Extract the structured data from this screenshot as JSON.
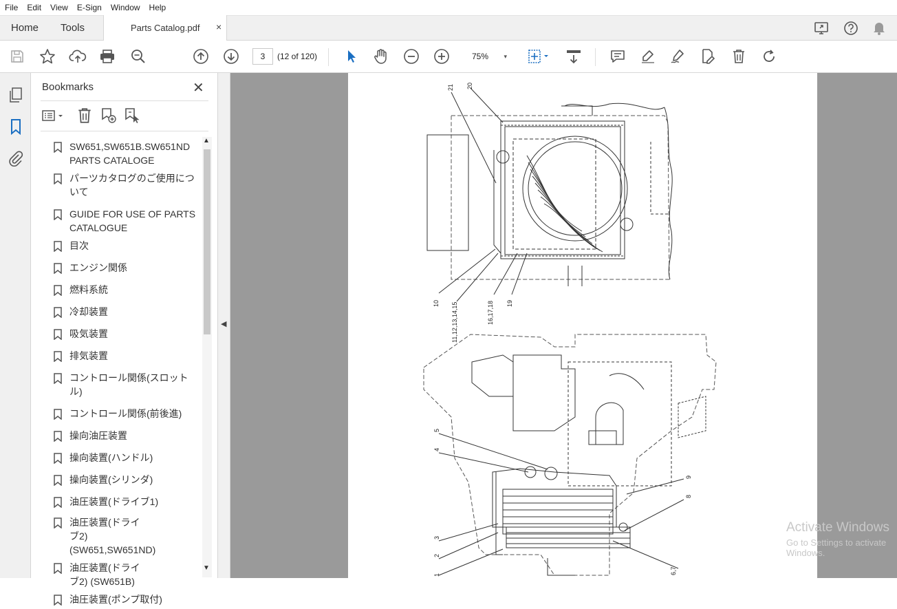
{
  "menu": [
    "File",
    "Edit",
    "View",
    "E-Sign",
    "Window",
    "Help"
  ],
  "tabs": {
    "home": "Home",
    "tools": "Tools",
    "document": "Parts Catalog.pdf",
    "close_glyph": "×"
  },
  "toolbar": {
    "page_number": "3",
    "page_count": "(12 of 120)",
    "zoom": "75%",
    "zoom_caret": "▾"
  },
  "bookmarks": {
    "title": "Bookmarks",
    "close_glyph": "✕",
    "items": [
      "SW651,SW651B.SW651ND PARTS CATALOGE",
      "パーツカタログのご使用について",
      "GUIDE FOR USE OF PARTS CATALOGUE",
      "目次",
      "エンジン関係",
      "燃料系統",
      "冷却装置",
      "吸気装置",
      "排気装置",
      "コントロール関係(スロットル)",
      "コントロール関係(前後進)",
      "操向油圧装置",
      "操向装置(ハンドル)",
      "操向装置(シリンダ)",
      "油圧装置(ドライブ1)",
      "油圧装置(ドライブ2) (SW651,SW651ND)",
      "油圧装置(ドライブ2) (SW651B)",
      "油圧装置(ポンプ取付)"
    ]
  },
  "scroll": {
    "up": "▲",
    "down": "▼",
    "collapse": "◀"
  },
  "drawing": {
    "top_labels": [
      "21",
      "20",
      "10",
      "11,12,13,14,15",
      "16,17,18",
      "19"
    ],
    "bottom_labels": [
      "5",
      "4",
      "3",
      "2",
      "1",
      "9",
      "8",
      "6,7"
    ]
  },
  "watermark": {
    "line1": "Activate Windows",
    "line2": "Go to Settings to activate Windows."
  }
}
